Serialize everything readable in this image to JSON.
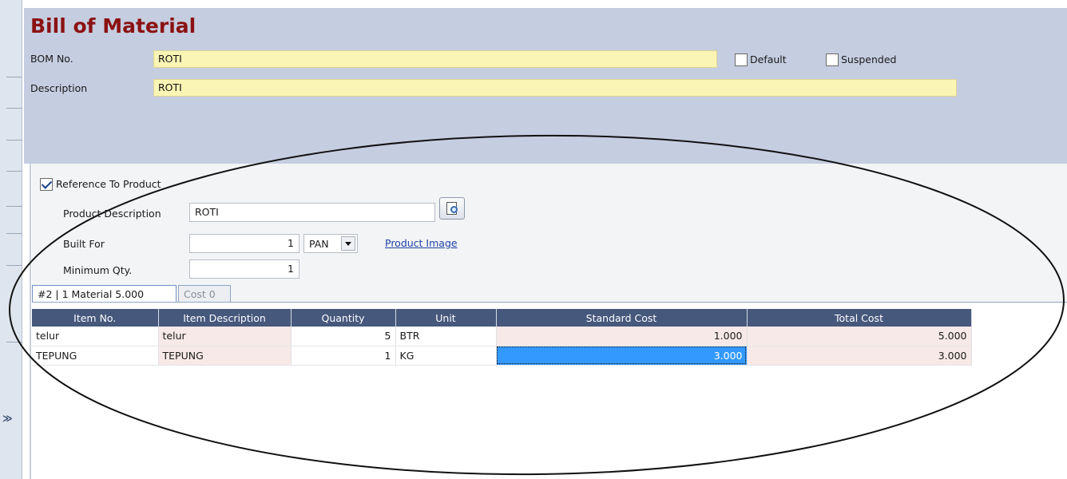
{
  "header": {
    "title": "Bill of Material",
    "bom_no_label": "BOM No.",
    "bom_no_value": "ROTI",
    "description_label": "Description",
    "description_value": "ROTI",
    "default_label": "Default",
    "default_checked": false,
    "suspended_label": "Suspended",
    "suspended_checked": false
  },
  "product": {
    "reference_label": "Reference To Product",
    "reference_checked": true,
    "description_label": "Product Description",
    "description_value": "ROTI",
    "built_for_label": "Built For",
    "built_for_value": "1",
    "unit_value": "PAN",
    "product_image_link": "Product Image",
    "min_qty_label": "Minimum Qty.",
    "min_qty_value": "1"
  },
  "tabs": [
    {
      "label": "#2 | 1 Material  5.000",
      "active": true
    },
    {
      "label": "Cost  0",
      "active": false
    }
  ],
  "grid": {
    "columns": [
      "Item No.",
      "Item Description",
      "Quantity",
      "Unit",
      "Standard Cost",
      "Total Cost"
    ],
    "rows": [
      {
        "item_no": "telur",
        "description": "telur",
        "quantity": "5",
        "unit": "BTR",
        "standard_cost": "1.000",
        "total_cost": "5.000"
      },
      {
        "item_no": "TEPUNG",
        "description": "TEPUNG",
        "quantity": "1",
        "unit": "KG",
        "standard_cost": "3.000",
        "total_cost": "3.000"
      }
    ]
  },
  "colors": {
    "title": "#8b1212",
    "header_bg": "#c5cde0",
    "field_yellow": "#fbf5b5",
    "grid_header": "#46587c",
    "selection": "#3399ff"
  }
}
